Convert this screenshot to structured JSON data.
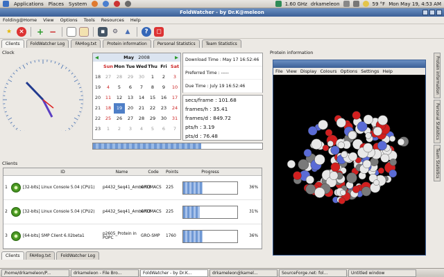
{
  "top_panel": {
    "menus": [
      "Applications",
      "Places",
      "System"
    ],
    "cpu": "1.60 GHz",
    "user": "drkameleon",
    "temp": "59 °F",
    "clock": "Mon May 19,  4:53 AM"
  },
  "window": {
    "title": "FoldWatcher - by Dr.K@meleon"
  },
  "menubar": [
    "Folding@Home",
    "View",
    "Options",
    "Tools",
    "Resources",
    "Help"
  ],
  "toolbar_icons": [
    "star-icon",
    "stop-icon",
    "add-icon",
    "remove-icon",
    "document-icon",
    "copy-icon",
    "save-icon",
    "settings-icon",
    "clean-icon",
    "help-icon",
    "close-icon"
  ],
  "tabs": [
    "Clients",
    "FoldWatcher Log",
    "FAHlog.txt",
    "Protein information",
    "Personal Statistics",
    "Team Statistics"
  ],
  "clock_panel": {
    "title": "Clock"
  },
  "calendar": {
    "month": "May",
    "year": "2008",
    "days_header": [
      "Sun",
      "Mon",
      "Tue",
      "Wed",
      "Thu",
      "Fri",
      "Sat"
    ],
    "weeks": [
      {
        "wk": "18",
        "days": [
          "27",
          "28",
          "29",
          "30",
          "1",
          "2",
          "3"
        ]
      },
      {
        "wk": "19",
        "days": [
          "4",
          "5",
          "6",
          "7",
          "8",
          "9",
          "10"
        ]
      },
      {
        "wk": "20",
        "days": [
          "11",
          "12",
          "13",
          "14",
          "15",
          "16",
          "17"
        ]
      },
      {
        "wk": "21",
        "days": [
          "18",
          "19",
          "20",
          "21",
          "22",
          "23",
          "24"
        ]
      },
      {
        "wk": "22",
        "days": [
          "25",
          "26",
          "27",
          "28",
          "29",
          "30",
          "31"
        ]
      },
      {
        "wk": "23",
        "days": [
          "1",
          "2",
          "3",
          "4",
          "5",
          "6",
          "7"
        ]
      }
    ],
    "selected": "19"
  },
  "dates": {
    "download": "Download Time : May 17 16:52:46",
    "preferred": "Preferred Time : -----",
    "due": "Due Time : July 19 16:52:46"
  },
  "stats": {
    "secs_frame": "secs/frame : 101.68",
    "frames_h": "frames/h : 35.41",
    "frames_d": "frames/d : 849.72",
    "pts_h": "pts/h : 3.19",
    "pts_d": "pts/d : 76.48"
  },
  "overall_progress": 0.64,
  "clients": {
    "title": "Clients",
    "headers": [
      "ID",
      "Name",
      "Code",
      "Points",
      "Progress"
    ],
    "rows": [
      {
        "num": "1",
        "id": "[32-bits] Linux Console 5.04 (CPU1)",
        "name": "p4432_Seq41_Amber03",
        "code": "GROMACS",
        "points": "225",
        "progress": 0.36,
        "progress_text": "36%"
      },
      {
        "num": "2",
        "id": "[32-bits] Linux Console 5.04 (CPU2)",
        "name": "p4432_Seq41_Amber03",
        "code": "GROMACS",
        "points": "225",
        "progress": 0.31,
        "progress_text": "31%"
      },
      {
        "num": "3",
        "id": "[64-bits] SMP Client 6.02beta1",
        "name": "p2605_Protein in POPC",
        "code": "GRO-SMP",
        "points": "1760",
        "progress": 0.36,
        "progress_text": "36%"
      }
    ]
  },
  "bottom_tabs": [
    "Clients",
    "FAHlog.txt",
    "FoldWatcher Log"
  ],
  "protein": {
    "title": "Protein information",
    "menu": [
      "File",
      "View",
      "Display",
      "Colours",
      "Options",
      "Settings",
      "Help"
    ]
  },
  "vertical_tabs": [
    "Protein information",
    "Personal Statistics",
    "Team Statistics"
  ],
  "taskbar": [
    "/home/drkameleon/P...",
    "drkameleon - File Bro...",
    "FoldWatcher - by Dr.K...",
    "drkameleon@kamel...",
    "SourceForge.net: fol...",
    "Untitled window"
  ]
}
